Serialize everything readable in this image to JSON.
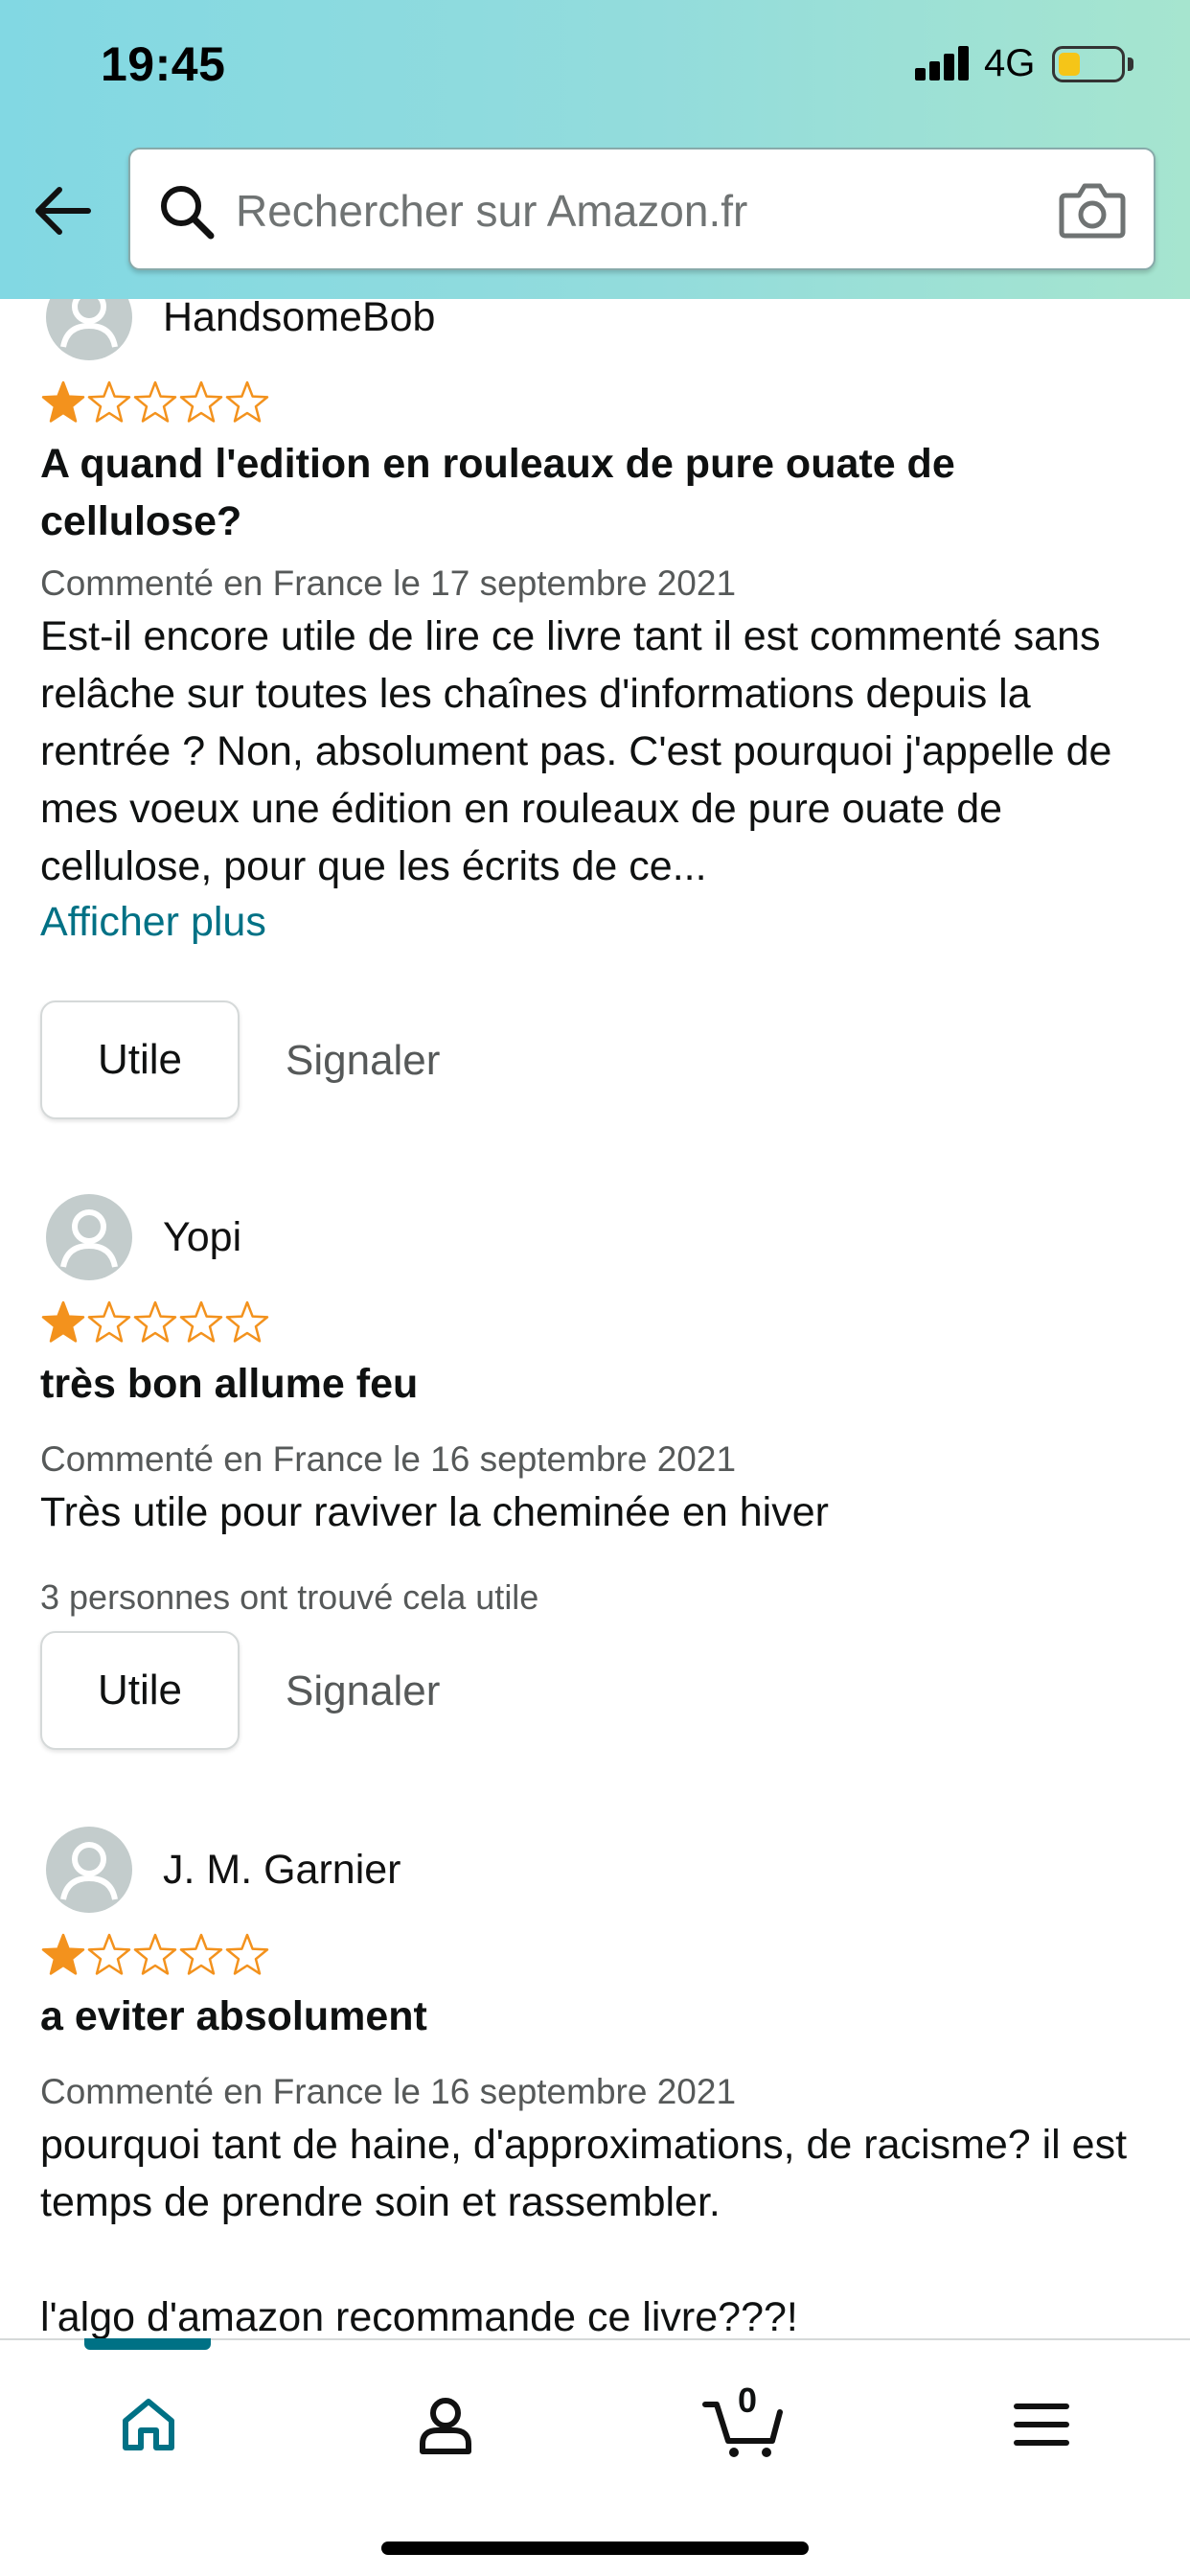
{
  "status_bar": {
    "time": "19:45",
    "network": "4G",
    "battery_fill": 0.35
  },
  "search": {
    "placeholder": "Rechercher sur Amazon.fr"
  },
  "reviews": [
    {
      "name": "HandsomeBob",
      "rating": 1,
      "max_rating": 5,
      "title": "A quand l'edition en rouleaux de pure ouate de cellulose?",
      "date": "Commenté en France le 17 septembre 2021",
      "body": "Est-il encore utile de lire ce livre tant il est commenté sans relâche sur toutes les chaînes d'informations depuis la rentrée ? Non, absolument pas. C'est pourquoi j'appelle de mes voeux une édition en rouleaux de pure ouate de cellulose, pour que les écrits de ce...",
      "show_more": "Afficher plus",
      "helpful_label": "Utile",
      "report_label": "Signaler"
    },
    {
      "name": "Yopi",
      "rating": 1,
      "max_rating": 5,
      "title": "très bon allume feu",
      "date": "Commenté en France le 16 septembre 2021",
      "body": "Très utile pour raviver la cheminée en hiver",
      "helpful_count": "3 personnes ont trouvé cela utile",
      "helpful_label": "Utile",
      "report_label": "Signaler"
    },
    {
      "name": "J. M. Garnier",
      "rating": 1,
      "max_rating": 5,
      "title": "a eviter absolument",
      "date": "Commenté en France le 16 septembre 2021",
      "body": "pourquoi tant de haine, d'approximations, de racisme? il est temps de prendre soin et rassembler.\n\nl'algo d'amazon recommande ce livre???!"
    }
  ],
  "bottom_nav": {
    "active": "home",
    "cart_count": "0",
    "items": [
      "home-icon",
      "account-icon",
      "cart-icon",
      "menu-icon"
    ]
  },
  "colors": {
    "accent": "#007185",
    "star": "#f3921d",
    "header_gradient_start": "#82d8e3",
    "header_gradient_end": "#a6e5cf"
  }
}
